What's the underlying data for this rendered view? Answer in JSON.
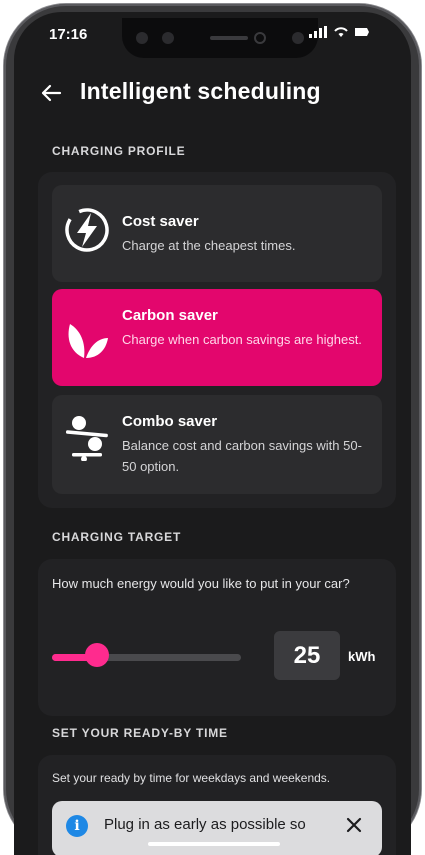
{
  "status": {
    "time": "17:16"
  },
  "header": {
    "title": "Intelligent scheduling"
  },
  "charging_profile": {
    "heading": "CHARGING PROFILE",
    "options": [
      {
        "title": "Cost saver",
        "description": "Charge at the cheapest times.",
        "selected": false,
        "icon": "lightning-icon"
      },
      {
        "title": "Carbon saver",
        "description": "Charge when carbon savings are highest.",
        "selected": true,
        "icon": "leaves-icon"
      },
      {
        "title": "Combo saver",
        "description": "Balance cost and carbon savings with 50-50 option.",
        "selected": false,
        "icon": "balance-icon"
      }
    ]
  },
  "charging_target": {
    "heading": "CHARGING TARGET",
    "question": "How much energy would you like to put in your car?",
    "value": "25",
    "unit": "kWh",
    "slider_fraction": 0.24
  },
  "ready_by": {
    "heading": "SET YOUR READY-BY TIME",
    "description": "Set your ready by time for weekdays and weekends.",
    "info_banner_text": "Plug in as early as possible so"
  },
  "colors": {
    "accent": "#e3066d",
    "slider": "#ff2b8e",
    "background": "#1b1b1c",
    "info": "#1e88e5"
  }
}
